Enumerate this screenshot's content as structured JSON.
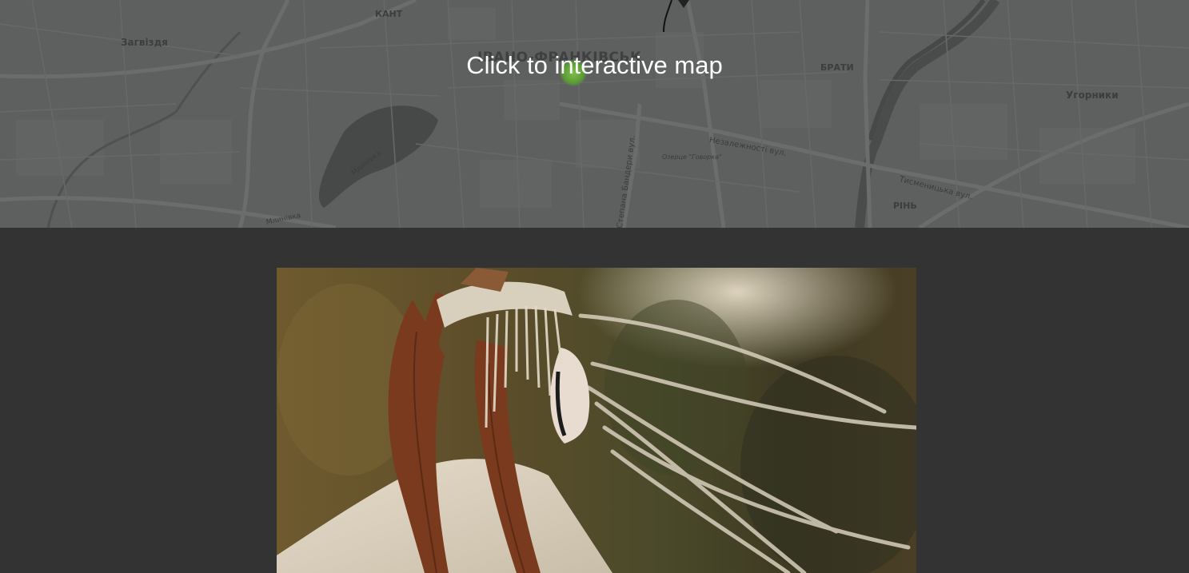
{
  "map": {
    "overlay_text": "Click to interactive map",
    "labels": {
      "city": "ІВАНО-ФРАНКІВСЬК",
      "zahvizdia": "Загвіздя",
      "kant": "КАНТ",
      "braty": "БРАТИ",
      "uhornyky": "Угорники",
      "rin": "РІНЬ",
      "nezalezhnosti": "Незалежності вул.",
      "tysmenytska": "Тисменицька вул.",
      "bandery": "Степана Бандери вул.",
      "ozero": "Озерце \"Говорка\"",
      "mlynivka": "Млинівка",
      "mlynivka2": "Млинівка"
    }
  },
  "colors": {
    "page_background": "#333333",
    "map_background": "#5e605f",
    "pin": "#6aa63e"
  },
  "photo": {
    "icon": "dancer-photo"
  }
}
